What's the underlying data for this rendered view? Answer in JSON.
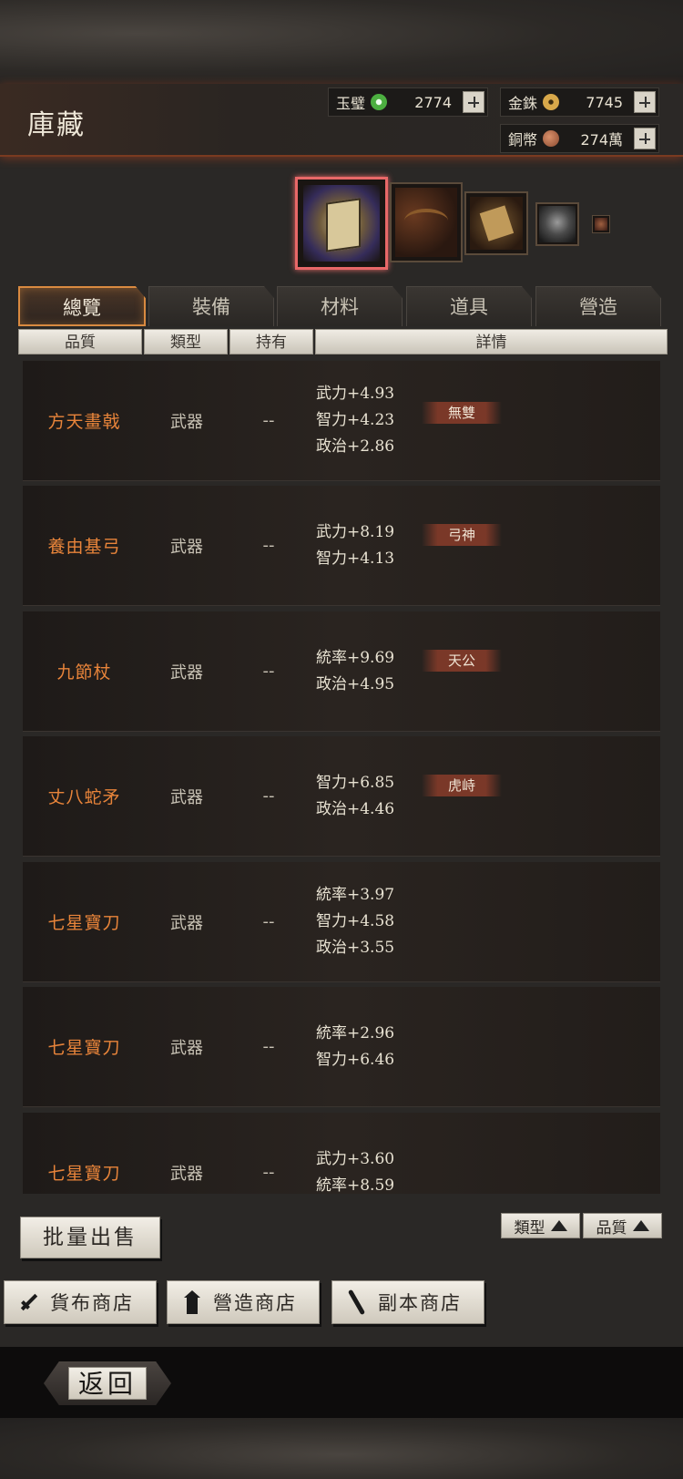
{
  "page_title": "庫藏",
  "currencies": [
    {
      "name": "玉璧",
      "value": "2774",
      "icon": "jade-coin-icon"
    },
    {
      "name": "金銖",
      "value": "7745",
      "icon": "gold-coin-icon"
    },
    {
      "name": "銅幣",
      "value": "274萬",
      "icon": "copper-coin-icon"
    }
  ],
  "tabs": [
    "總覽",
    "裝備",
    "材料",
    "道具",
    "營造"
  ],
  "active_tab": "總覽",
  "columns": [
    "品質",
    "類型",
    "持有",
    "詳情"
  ],
  "items": [
    {
      "name": "方天畫戟",
      "type": "武器",
      "held": "--",
      "stats": [
        "武力+4.93",
        "智力+4.23",
        "政治+2.86"
      ],
      "tag": "無雙"
    },
    {
      "name": "養由基弓",
      "type": "武器",
      "held": "--",
      "stats": [
        "武力+8.19",
        "智力+4.13"
      ],
      "tag": "弓神"
    },
    {
      "name": "九節杖",
      "type": "武器",
      "held": "--",
      "stats": [
        "統率+9.69",
        "政治+4.95"
      ],
      "tag": "天公"
    },
    {
      "name": "丈八蛇矛",
      "type": "武器",
      "held": "--",
      "stats": [
        "智力+6.85",
        "政治+4.46"
      ],
      "tag": "虎峙"
    },
    {
      "name": "七星寶刀",
      "type": "武器",
      "held": "--",
      "stats": [
        "統率+3.97",
        "智力+4.58",
        "政治+3.55"
      ],
      "tag": ""
    },
    {
      "name": "七星寶刀",
      "type": "武器",
      "held": "--",
      "stats": [
        "統率+2.96",
        "智力+6.46"
      ],
      "tag": ""
    },
    {
      "name": "七星寶刀",
      "type": "武器",
      "held": "--",
      "stats": [
        "武力+3.60",
        "統率+8.59"
      ],
      "tag": ""
    }
  ],
  "batch_sell_label": "批量出售",
  "sort_buttons": [
    "類型",
    "品質"
  ],
  "shop_buttons": [
    {
      "label": "貨布商店",
      "icon": "arrow-icon"
    },
    {
      "label": "營造商店",
      "icon": "tower-icon"
    },
    {
      "label": "副本商店",
      "icon": "blade-icon"
    }
  ],
  "back_label": "返回"
}
